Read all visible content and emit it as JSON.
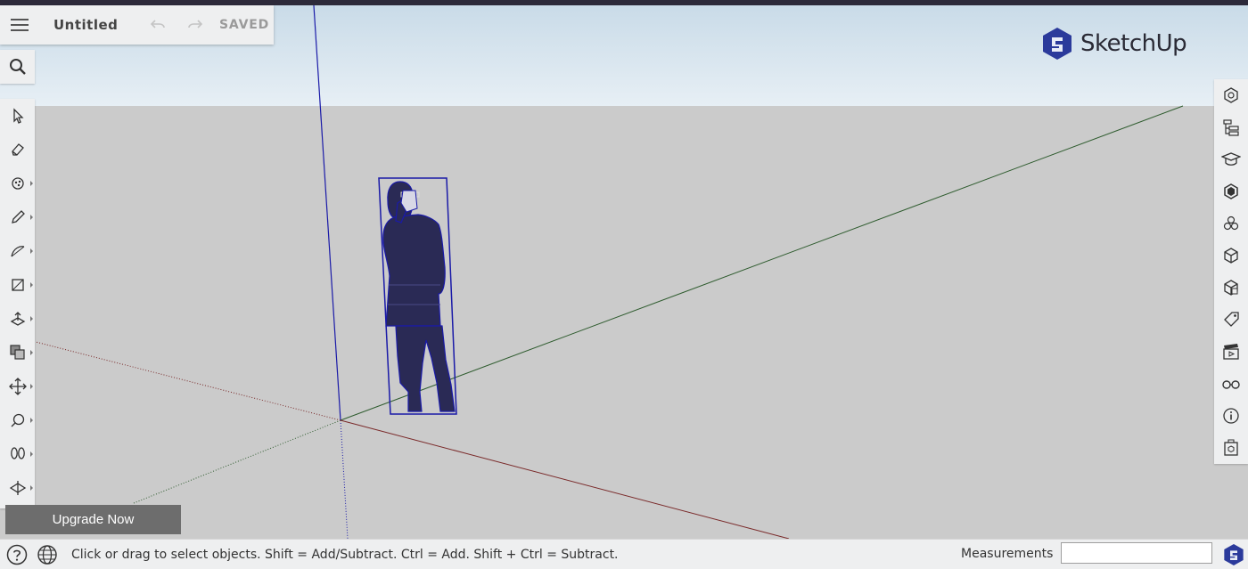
{
  "title_bar": {
    "document_title": "Untitled",
    "save_status": "SAVED"
  },
  "brand": {
    "name": "SketchUp",
    "accent_color": "#2b3a9b"
  },
  "left_toolbar": {
    "items": [
      "select-icon",
      "eraser-icon",
      "paint-bucket-icon",
      "pencil-icon",
      "arc-icon",
      "rectangle-icon",
      "push-pull-icon",
      "offset-icon",
      "move-icon",
      "tape-measure-icon",
      "walk-icon",
      "section-plane-icon"
    ]
  },
  "right_toolbar": {
    "items": [
      "entity-info-icon",
      "outliner-icon",
      "instructor-icon",
      "components-icon",
      "materials-icon",
      "styles-icon",
      "solid-tools-icon",
      "tags-icon",
      "scenes-icon",
      "display-icon",
      "model-info-icon",
      "3d-warehouse-icon"
    ]
  },
  "upgrade_button": {
    "label": "Upgrade Now"
  },
  "status_bar": {
    "hint_text": "Click or drag to select objects. Shift = Add/Subtract. Ctrl = Add. Shift + Ctrl = Subtract.",
    "measurements_label": "Measurements",
    "measurements_value": ""
  },
  "colors": {
    "selection_blue": "#1a1aa8",
    "ground": "#cbcbcb",
    "sky_top": "#c9dbe8",
    "sky_bottom": "#e7eff5"
  }
}
